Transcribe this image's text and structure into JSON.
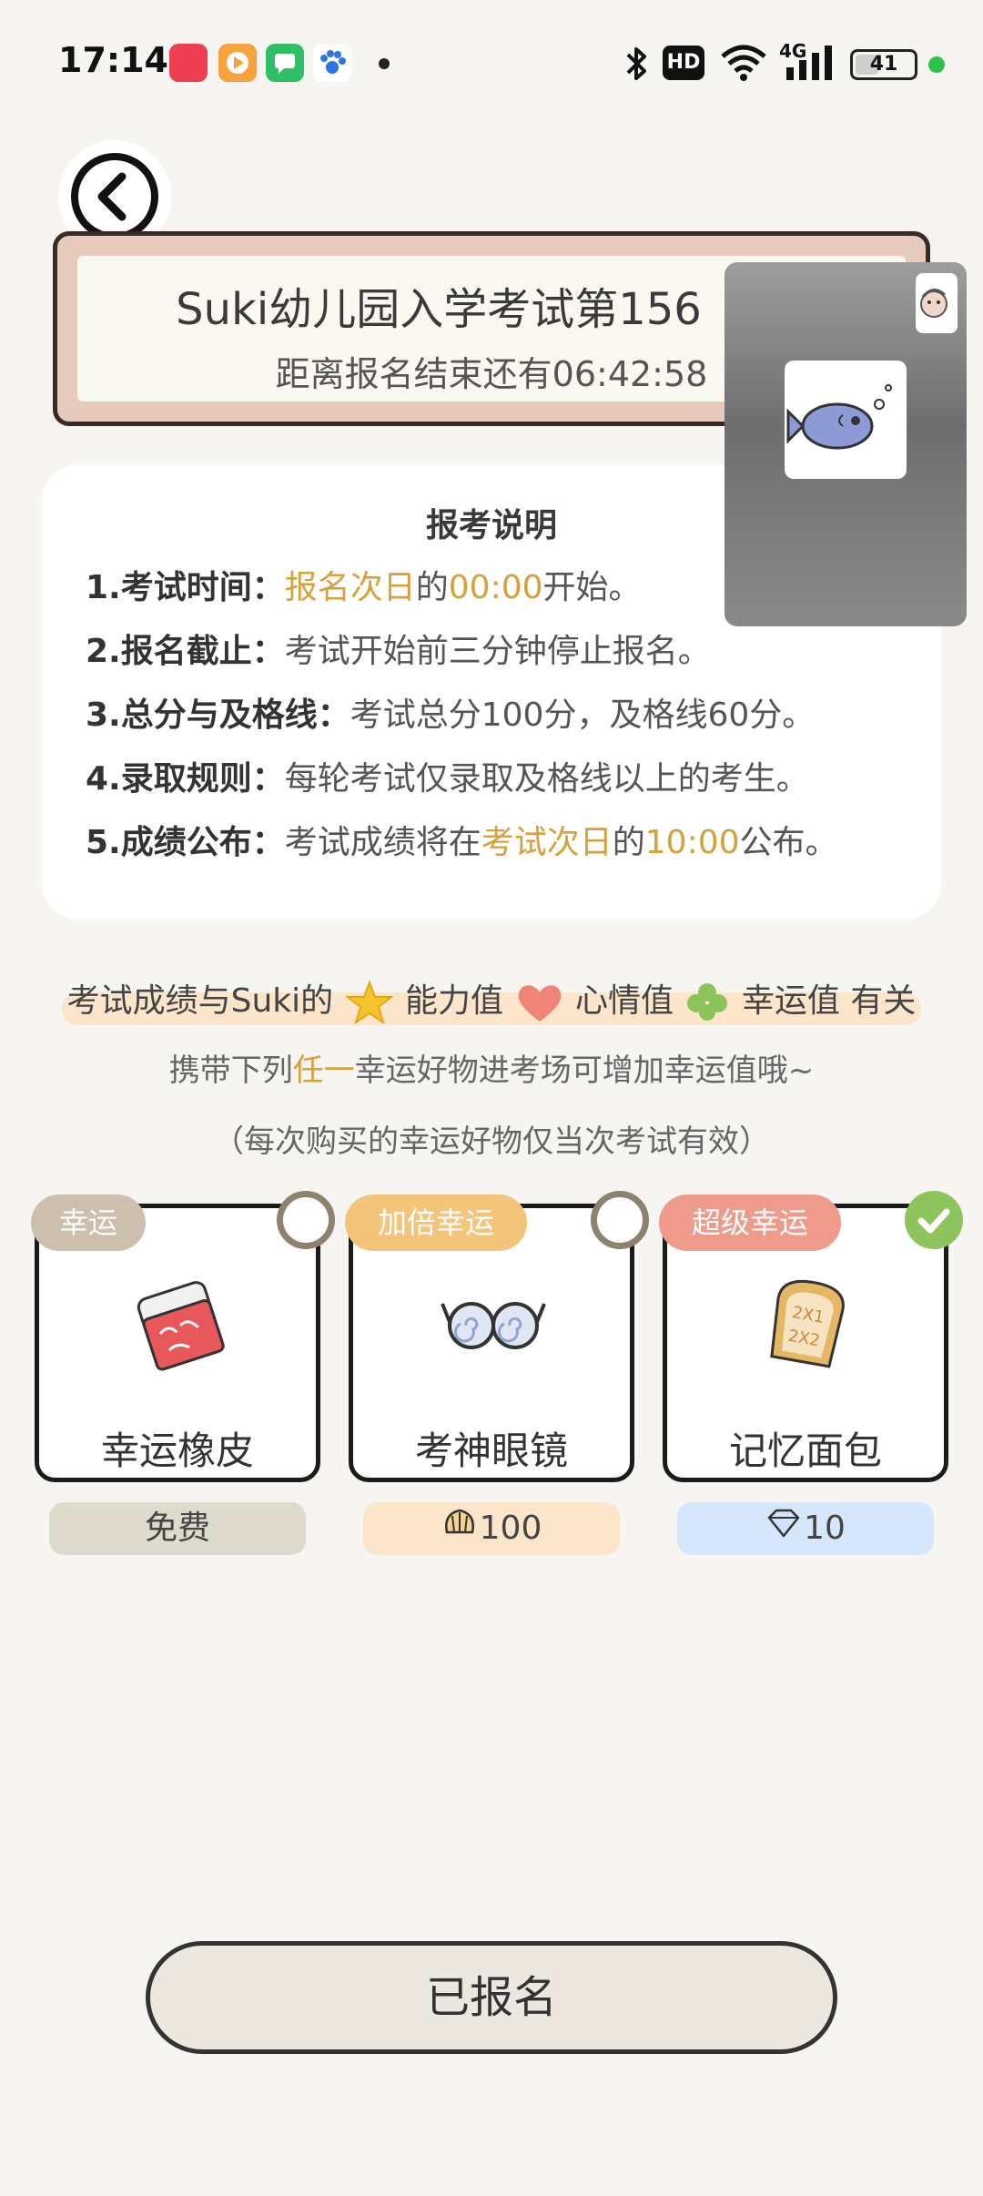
{
  "status_bar": {
    "time": "17:14",
    "battery": "41",
    "battery_level": 0.41,
    "network": "4G",
    "hd_label": "HD",
    "app_icons": [
      "red-app-icon",
      "play-icon",
      "chat-icon",
      "paw-icon"
    ]
  },
  "header": {
    "title": "Suki幼儿园入学考试第156",
    "countdown": "距离报名结束还有06:42:58"
  },
  "info": {
    "title": "报考说明",
    "rules": [
      {
        "key": "1.考试时间：",
        "parts": [
          {
            "text": "报名次日",
            "hl": true
          },
          {
            "text": "的",
            "hl": false
          },
          {
            "text": "00:00",
            "hl": true
          },
          {
            "text": "开始。",
            "hl": false
          }
        ]
      },
      {
        "key": "2.报名截止：",
        "parts": [
          {
            "text": "考试开始前三分钟停止报名。",
            "hl": false
          }
        ]
      },
      {
        "key": "3.总分与及格线：",
        "parts": [
          {
            "text": "考试总分100分，及格线60分。",
            "hl": false
          }
        ]
      },
      {
        "key": "4.录取规则：",
        "parts": [
          {
            "text": "每轮考试仅录取及格线以上的考生。",
            "hl": false
          }
        ]
      },
      {
        "key": "5.成绩公布：",
        "parts": [
          {
            "text": "考试成绩将在",
            "hl": false
          },
          {
            "text": "考试次日",
            "hl": true
          },
          {
            "text": "的",
            "hl": false
          },
          {
            "text": "10:00",
            "hl": true
          },
          {
            "text": "公布。",
            "hl": false
          }
        ]
      }
    ]
  },
  "luck": {
    "line_prefix": "考试成绩与Suki的",
    "ability": "能力值",
    "mood": "心情值",
    "luck": "幸运值",
    "suffix": "有关",
    "carry_prefix": "携带下列",
    "carry_highlight": "任一",
    "carry_suffix": "幸运好物进考场可增加幸运值哦~",
    "note": "（每次购买的幸运好物仅当次考试有效）"
  },
  "items": [
    {
      "tag": "幸运",
      "tag_color": "#cdbfae",
      "name": "幸运橡皮",
      "price": "免费",
      "price_bg": "#dedbcd",
      "price_icon": "",
      "selected": false
    },
    {
      "tag": "加倍幸运",
      "tag_color": "#f3c47a",
      "name": "考神眼镜",
      "price": "100",
      "price_bg": "#fbe6cc",
      "price_icon": "shell-icon",
      "selected": false
    },
    {
      "tag": "超级幸运",
      "tag_color": "#ef9b8c",
      "name": "记忆面包",
      "price": "10",
      "price_bg": "#d7e7fb",
      "price_icon": "diamond-icon",
      "selected": true
    }
  ],
  "action": {
    "label": "已报名"
  },
  "colors": {
    "highlight": "#d6a03b",
    "background": "#f7f5f2"
  }
}
